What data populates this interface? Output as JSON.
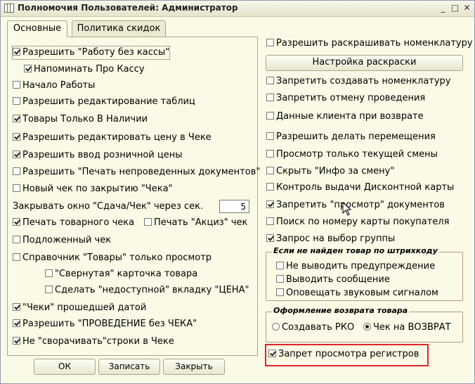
{
  "window": {
    "title": "Полномочия Пользователей: Администратор"
  },
  "tabs": [
    {
      "label": "Основные"
    },
    {
      "label": "Политика скидок"
    }
  ],
  "left": {
    "allow_no_cashbox": "Разрешить \"Работу без кассы\"",
    "remind_cashbox": "Напоминать Про Кассу",
    "work_start": "Начало Работы",
    "allow_edit_tables": "Разрешить редактирование таблиц",
    "only_in_stock": "Товары Только В Наличии",
    "allow_edit_price_receipt": "Разрешить редактировать цену в Чеке",
    "allow_retail_price_input": "Разрешить ввод розничной цены",
    "allow_print_unposted": "Разрешить \"Печать непроведенных документов\"",
    "new_receipt_on_close": "Новый чек по закрытию \"Чека\"",
    "close_change_label": "Закрывать окно \"Сдача/Чек\" через сек.",
    "close_change_value": "5",
    "print_goods_receipt": "Печать товарного чека",
    "print_excise": "Печать \"Акциз\" чек",
    "fake_receipt": "Подложенный чек",
    "goods_ref_readonly": "Справочник \"Товары\" только просмотр",
    "collapsed_card": "\"Свернутая\" карточка товара",
    "price_tab_unavailable": "Сделать \"недоступной\" вкладку \"ЦЕНА\"",
    "receipts_past_date": "\"Чеки\" прошедшей датой",
    "allow_post_without_receipt": "Разрешить \"ПРОВЕДЕНИЕ без ЧЕКА\"",
    "no_collapse_rows": "Не \"сворачивать\"строки в Чеке"
  },
  "buttons": {
    "ok": "ОК",
    "save": "Записать",
    "close": "Закрыть",
    "coloring_settings": "Настройка раскраски"
  },
  "right": {
    "allow_coloring": "Разрешить раскрашивать номенклатуру",
    "forbid_create_nomenclature": "Запретить создавать номенклатуру",
    "forbid_cancel_posting": "Запретить отмену проведения",
    "client_data_return": "Данные клиента при возврате",
    "allow_transfers": "Разрешить делать перемещения",
    "view_current_shift": "Просмотр только текущей смены",
    "hide_shift_info": "Скрыть \"Инфо за смену\"",
    "discount_card_control": "Контроль выдачи Дисконтной карты",
    "forbid_view_documents": "Запретить \"просмотр\" документов",
    "search_by_card_number": "Поиск по номеру карты покупателя",
    "group_selection_request": "Запрос на выбор группы",
    "barcode_group_title": "Если не найден товар по штрихкоду",
    "no_warning": "Не выводить предупреждение",
    "show_message": "Выводить сообщение",
    "sound_signal": "Оповещать звуковым сигналом",
    "return_group_title": "Оформление возврата товара",
    "create_rko": "Создавать РКО",
    "receipt_return": "Чек на ВОЗВРАТ",
    "forbid_view_registers": "Запрет просмотра регистров"
  },
  "state": {
    "allow_no_cashbox": true,
    "remind_cashbox": true,
    "work_start": false,
    "allow_edit_tables": false,
    "only_in_stock": true,
    "allow_edit_price_receipt": true,
    "allow_retail_price_input": true,
    "allow_print_unposted": false,
    "new_receipt_on_close": false,
    "print_goods_receipt": true,
    "print_excise": false,
    "fake_receipt": false,
    "goods_ref_readonly": false,
    "collapsed_card": false,
    "price_tab_unavailable": false,
    "receipts_past_date": true,
    "allow_post_without_receipt": true,
    "no_collapse_rows": true,
    "allow_coloring": false,
    "forbid_create_nomenclature": false,
    "forbid_cancel_posting": false,
    "client_data_return": false,
    "allow_transfers": false,
    "view_current_shift": false,
    "hide_shift_info": false,
    "discount_card_control": false,
    "forbid_view_documents": true,
    "search_by_card_number": false,
    "group_selection_request": true,
    "no_warning": false,
    "show_message": false,
    "sound_signal": false,
    "return_mode": "receipt_return",
    "forbid_view_registers": true
  },
  "colors": {
    "background": "#fbfae6",
    "highlight": "#e0252a"
  }
}
